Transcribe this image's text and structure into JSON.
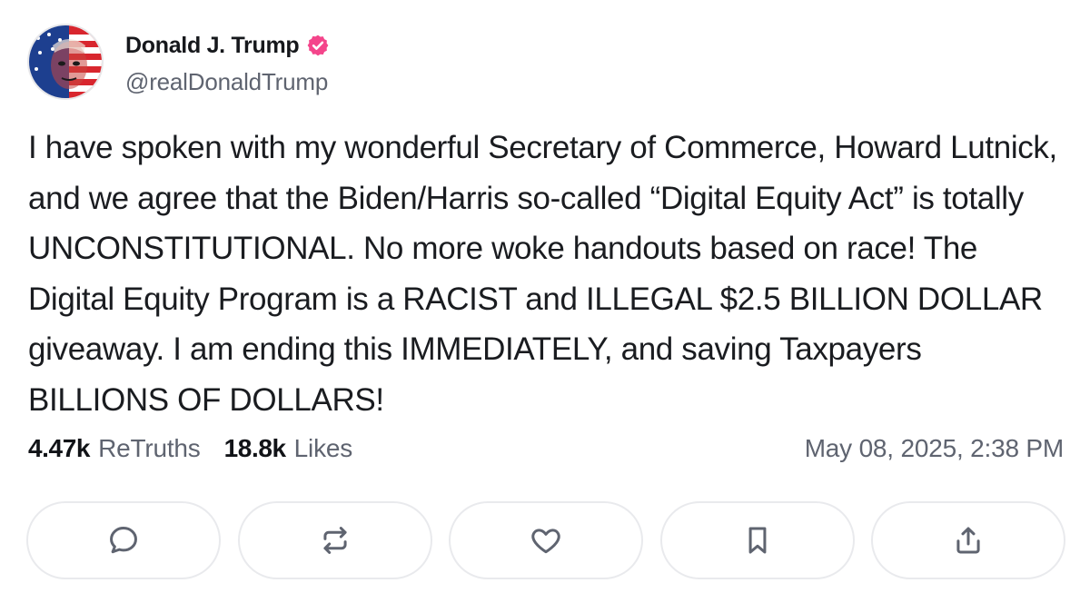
{
  "author": {
    "display_name": "Donald J. Trump",
    "handle": "@realDonaldTrump",
    "verified_color": "#f4458b"
  },
  "post": {
    "text": "I have spoken with my wonderful Secretary of Commerce, Howard Lutnick, and we agree that the Biden/Harris so-called “Digital Equity Act” is totally UNCONSTITUTIONAL. No more woke handouts based on race! The Digital Equity Program is a RACIST and ILLEGAL $2.5 BILLION DOLLAR giveaway. I am ending this IMMEDIATELY, and saving Taxpayers BILLIONS OF DOLLARS!"
  },
  "stats": {
    "retruths_count": "4.47k",
    "retruths_label": "ReTruths",
    "likes_count": "18.8k",
    "likes_label": "Likes",
    "timestamp": "May 08, 2025, 2:38 PM"
  },
  "actions": [
    {
      "icon": "comment-icon"
    },
    {
      "icon": "retruth-icon"
    },
    {
      "icon": "heart-icon"
    },
    {
      "icon": "bookmark-icon"
    },
    {
      "icon": "share-icon"
    }
  ],
  "colors": {
    "text": "#1a1c20",
    "muted": "#5f6470",
    "icon": "#5f6470",
    "border": "#e9eaed"
  }
}
